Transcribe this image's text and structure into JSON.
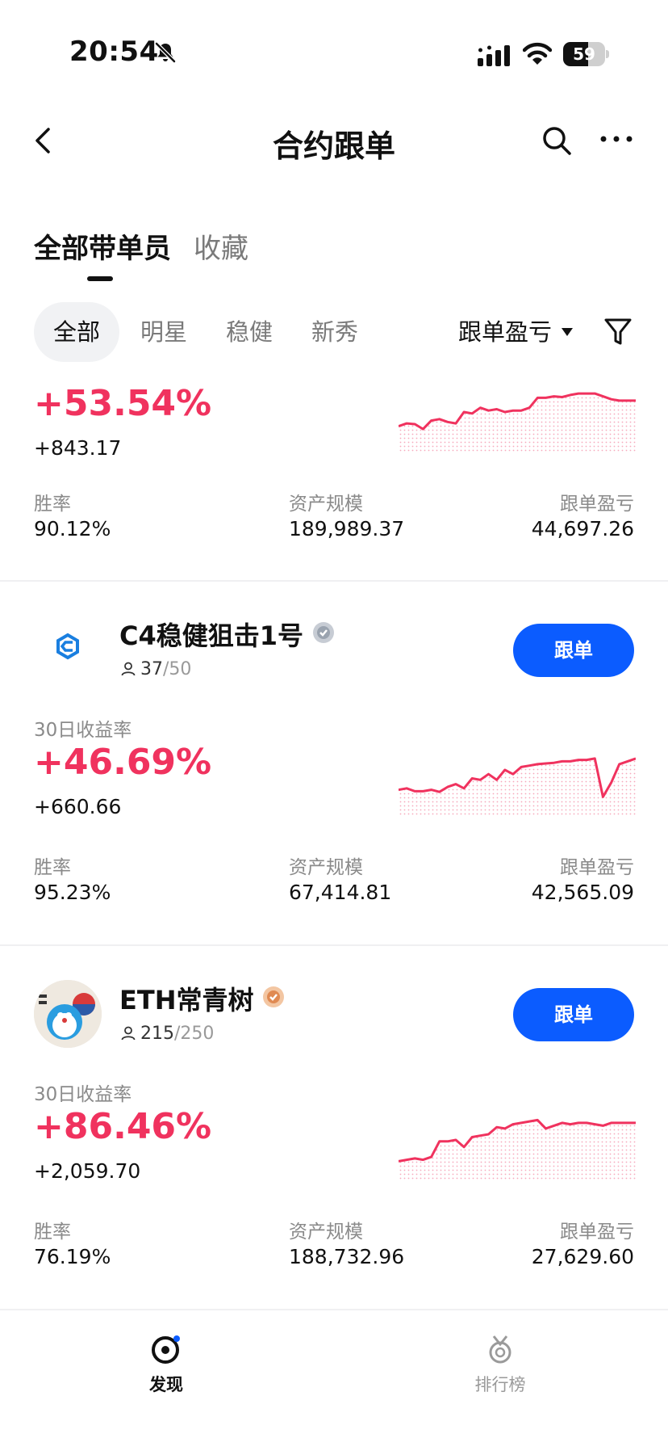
{
  "status_bar": {
    "time": "20:54",
    "battery": "59",
    "battery_level": 0.59
  },
  "nav": {
    "title": "合约跟单"
  },
  "tabs": [
    {
      "label": "全部带单员"
    },
    {
      "label": "收藏"
    }
  ],
  "chips": [
    {
      "label": "全部"
    },
    {
      "label": "明星"
    },
    {
      "label": "稳健"
    },
    {
      "label": "新秀"
    }
  ],
  "sort": {
    "label": "跟单盈亏"
  },
  "cards": [
    {
      "return_rate": "+53.54%",
      "pnl": "+843.17",
      "win_rate_label": "胜率",
      "win_rate": "90.12%",
      "aum_label": "资产规模",
      "aum": "189,989.37",
      "copy_pnl_label": "跟单盈亏",
      "copy_pnl": "44,697.26",
      "sparkline": [
        30,
        34,
        33,
        26,
        38,
        40,
        36,
        34,
        50,
        48,
        56,
        52,
        54,
        50,
        52,
        52,
        56,
        70,
        70,
        72,
        71,
        74,
        76,
        76,
        76,
        72,
        68,
        66,
        66,
        66
      ]
    },
    {
      "name": "C4稳健狙击1号",
      "followers": "37",
      "followers_max": "/50",
      "follow_label": "跟单",
      "return_label": "30日收益率",
      "return_rate": "+46.69%",
      "pnl": "+660.66",
      "win_rate_label": "胜率",
      "win_rate": "95.23%",
      "aum_label": "资产规模",
      "aum": "67,414.81",
      "copy_pnl_label": "跟单盈亏",
      "copy_pnl": "42,565.09",
      "sparkline": [
        30,
        32,
        28,
        28,
        30,
        27,
        34,
        38,
        32,
        46,
        44,
        52,
        44,
        58,
        52,
        62,
        64,
        66,
        67,
        68,
        70,
        70,
        72,
        72,
        74,
        20,
        40,
        66,
        70,
        74
      ]
    },
    {
      "name": "ETH常青树",
      "followers": "215",
      "followers_max": "/250",
      "follow_label": "跟单",
      "return_label": "30日收益率",
      "return_rate": "+86.46%",
      "pnl": "+2,059.70",
      "win_rate_label": "胜率",
      "win_rate": "76.19%",
      "aum_label": "资产规模",
      "aum": "188,732.96",
      "copy_pnl_label": "跟单盈亏",
      "copy_pnl": "27,629.60",
      "sparkline": [
        20,
        22,
        24,
        22,
        26,
        48,
        48,
        50,
        40,
        54,
        56,
        58,
        68,
        66,
        72,
        74,
        76,
        78,
        66,
        70,
        74,
        72,
        74,
        74,
        72,
        70,
        74,
        74,
        74,
        74
      ]
    }
  ],
  "bottom_nav": [
    {
      "label": "发现"
    },
    {
      "label": "排行榜"
    }
  ],
  "colors": {
    "accent": "#0b5cff",
    "up": "#f0325e"
  }
}
